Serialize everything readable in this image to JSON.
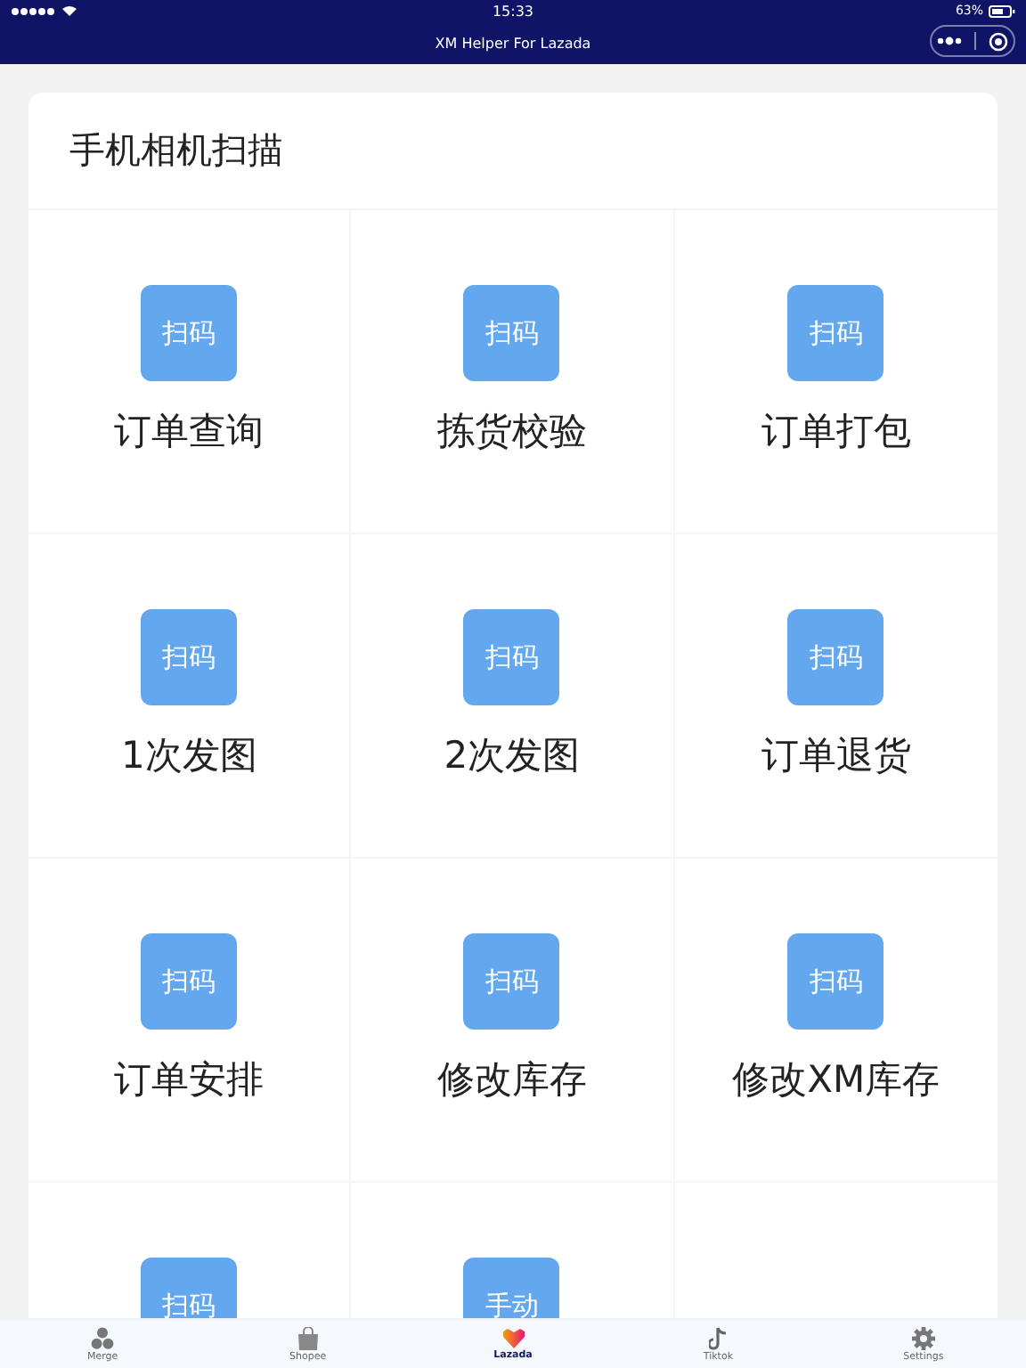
{
  "status_bar": {
    "time": "15:33",
    "battery": "63%"
  },
  "nav": {
    "title": "XM Helper For Lazada"
  },
  "card": {
    "title": "手机相机扫描",
    "items": [
      {
        "button": "扫码",
        "label": "订单查询"
      },
      {
        "button": "扫码",
        "label": "拣货校验"
      },
      {
        "button": "扫码",
        "label": "订单打包"
      },
      {
        "button": "扫码",
        "label": "1次发图"
      },
      {
        "button": "扫码",
        "label": "2次发图"
      },
      {
        "button": "扫码",
        "label": "订单退货"
      },
      {
        "button": "扫码",
        "label": "订单安排"
      },
      {
        "button": "扫码",
        "label": "修改库存"
      },
      {
        "button": "扫码",
        "label": "修改XM库存"
      },
      {
        "button": "扫码"
      },
      {
        "button": "手动"
      }
    ]
  },
  "tab_bar": [
    {
      "label": "Merge",
      "kind": "merge",
      "selected": false
    },
    {
      "label": "Shopee",
      "kind": "bag",
      "selected": false
    },
    {
      "label": "Lazada",
      "kind": "heart",
      "selected": true
    },
    {
      "label": "Tiktok",
      "kind": "note",
      "selected": false
    },
    {
      "label": "Settings",
      "kind": "gear",
      "selected": false
    }
  ]
}
